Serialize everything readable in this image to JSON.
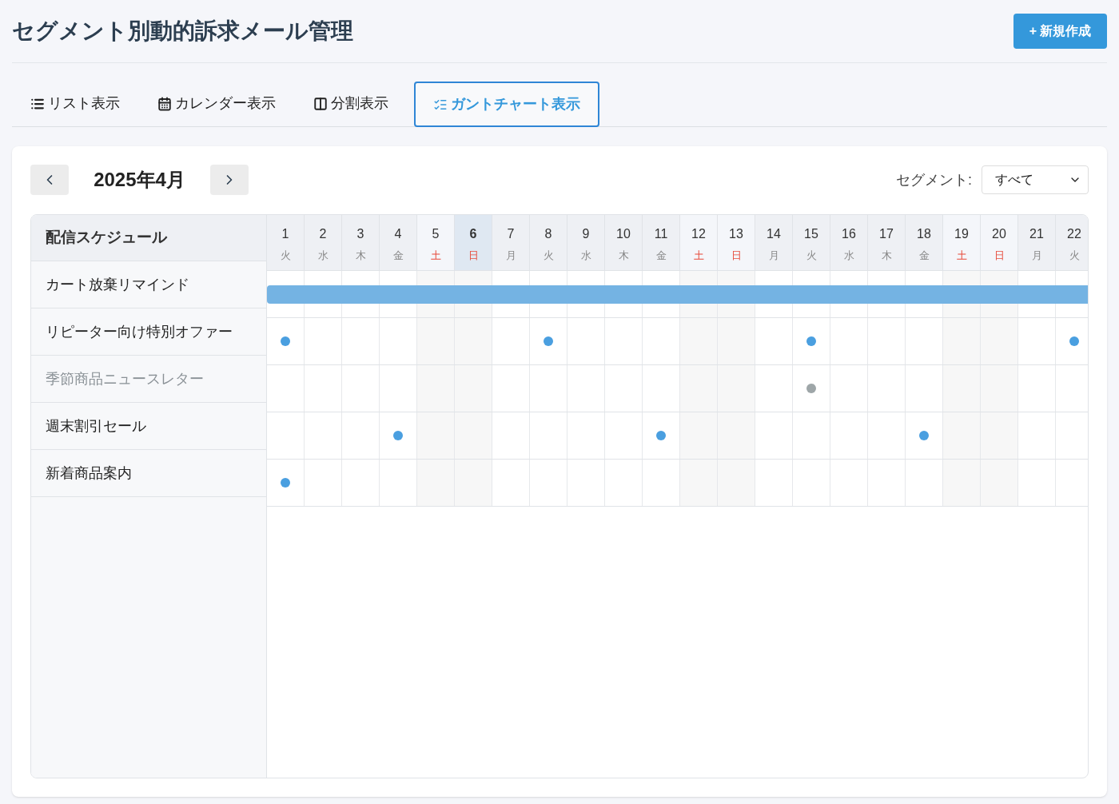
{
  "title": "セグメント別動的訴求メール管理",
  "new_button": {
    "icon": "+",
    "label": "新規作成"
  },
  "tabs": [
    {
      "kind": "list",
      "label": "リスト表示",
      "selected": false
    },
    {
      "kind": "calendar",
      "label": "カレンダー表示",
      "selected": false
    },
    {
      "kind": "split",
      "label": "分割表示",
      "selected": false
    },
    {
      "kind": "gantt",
      "label": "ガントチャート表示",
      "selected": true
    }
  ],
  "month": "2025年4月",
  "segment_filter": {
    "label": "セグメント:",
    "value": "すべて"
  },
  "schedule_heading": "配信スケジュール",
  "days": [
    {
      "day": "1",
      "weekday": "火",
      "kind": "weekday",
      "today": false
    },
    {
      "day": "2",
      "weekday": "水",
      "kind": "weekday",
      "today": false
    },
    {
      "day": "3",
      "weekday": "木",
      "kind": "weekday",
      "today": false
    },
    {
      "day": "4",
      "weekday": "金",
      "kind": "weekday",
      "today": false
    },
    {
      "day": "5",
      "weekday": "土",
      "kind": "weekend",
      "today": false
    },
    {
      "day": "6",
      "weekday": "日",
      "kind": "weekend",
      "today": true
    },
    {
      "day": "7",
      "weekday": "月",
      "kind": "weekday",
      "today": false
    },
    {
      "day": "8",
      "weekday": "火",
      "kind": "weekday",
      "today": false
    },
    {
      "day": "9",
      "weekday": "水",
      "kind": "weekday",
      "today": false
    },
    {
      "day": "10",
      "weekday": "木",
      "kind": "weekday",
      "today": false
    },
    {
      "day": "11",
      "weekday": "金",
      "kind": "weekday",
      "today": false
    },
    {
      "day": "12",
      "weekday": "土",
      "kind": "weekend",
      "today": false
    },
    {
      "day": "13",
      "weekday": "日",
      "kind": "weekend",
      "today": false
    },
    {
      "day": "14",
      "weekday": "月",
      "kind": "weekday",
      "today": false
    },
    {
      "day": "15",
      "weekday": "火",
      "kind": "weekday",
      "today": false
    },
    {
      "day": "16",
      "weekday": "水",
      "kind": "weekday",
      "today": false
    },
    {
      "day": "17",
      "weekday": "木",
      "kind": "weekday",
      "today": false
    },
    {
      "day": "18",
      "weekday": "金",
      "kind": "weekday",
      "today": false
    },
    {
      "day": "19",
      "weekday": "土",
      "kind": "weekend",
      "today": false
    },
    {
      "day": "20",
      "weekday": "日",
      "kind": "weekend",
      "today": false
    },
    {
      "day": "21",
      "weekday": "月",
      "kind": "weekday",
      "today": false
    },
    {
      "day": "22",
      "weekday": "火",
      "kind": "weekday",
      "today": false
    }
  ],
  "segments": [
    {
      "name": "カート放棄リマインド",
      "active": true,
      "kind": "bar",
      "color": "#74b3e3"
    },
    {
      "name": "リピーター向け特別オファー",
      "active": true,
      "kind": "dots",
      "color": "#4a9fe0",
      "sends": [
        true,
        false,
        false,
        false,
        false,
        false,
        false,
        true,
        false,
        false,
        false,
        false,
        false,
        false,
        true,
        false,
        false,
        false,
        false,
        false,
        false,
        true
      ]
    },
    {
      "name": "季節商品ニュースレター",
      "active": false,
      "kind": "dots",
      "color": "#9ea6a8",
      "sends": [
        false,
        false,
        false,
        false,
        false,
        false,
        false,
        false,
        false,
        false,
        false,
        false,
        false,
        false,
        true,
        false,
        false,
        false,
        false,
        false,
        false,
        false
      ]
    },
    {
      "name": "週末割引セール",
      "active": true,
      "kind": "dots",
      "color": "#4a9fe0",
      "sends": [
        false,
        false,
        false,
        true,
        false,
        false,
        false,
        false,
        false,
        false,
        true,
        false,
        false,
        false,
        false,
        false,
        false,
        true,
        false,
        false,
        false,
        false
      ]
    },
    {
      "name": "新着商品案内",
      "active": true,
      "kind": "dots",
      "color": "#4a9fe0",
      "sends": [
        true,
        false,
        false,
        false,
        false,
        false,
        false,
        false,
        false,
        false,
        false,
        false,
        false,
        false,
        false,
        false,
        false,
        false,
        false,
        false,
        false,
        false
      ]
    }
  ]
}
